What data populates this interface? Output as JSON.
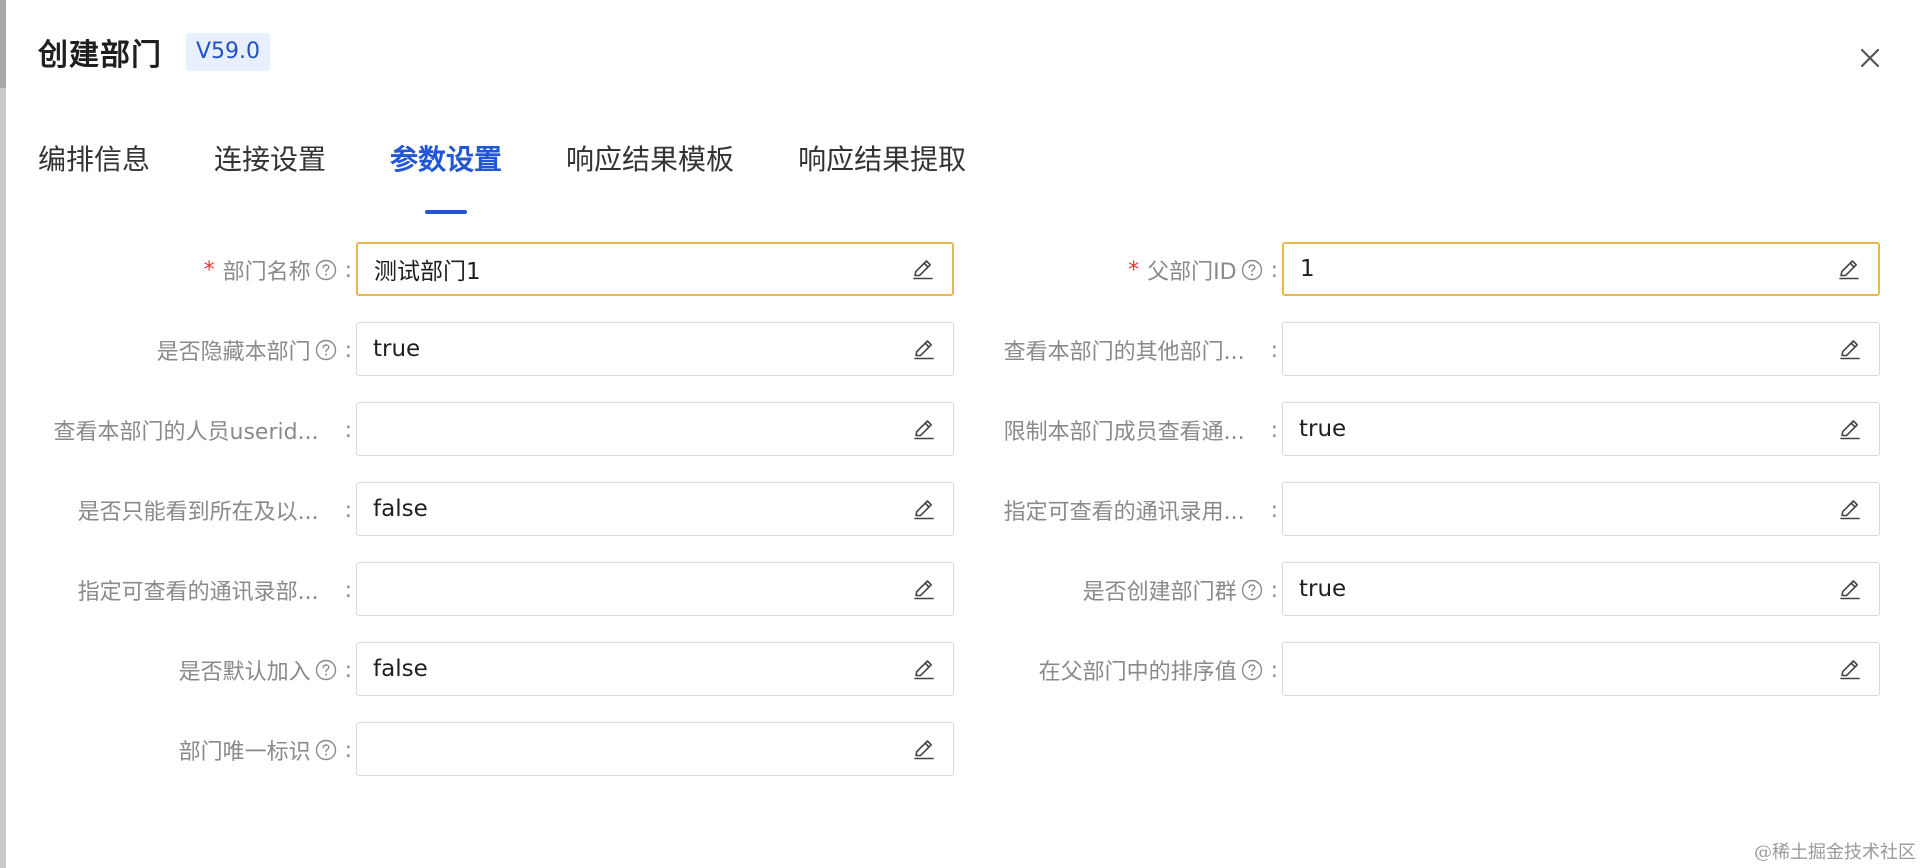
{
  "dialog": {
    "title": "创建部门",
    "version": "V59.0"
  },
  "tabs": [
    {
      "label": "编排信息",
      "active": false
    },
    {
      "label": "连接设置",
      "active": false
    },
    {
      "label": "参数设置",
      "active": true
    },
    {
      "label": "响应结果模板",
      "active": false
    },
    {
      "label": "响应结果提取",
      "active": false
    }
  ],
  "form": {
    "fields": [
      {
        "label": "部门名称",
        "required": true,
        "help": true,
        "value": "测试部门1",
        "focused": true
      },
      {
        "label": "父部门ID",
        "required": true,
        "help": true,
        "value": "1",
        "focused": true
      },
      {
        "label": "是否隐藏本部门",
        "required": false,
        "help": true,
        "value": "true"
      },
      {
        "label": "查看本部门的其他部门...",
        "required": false,
        "help": false,
        "value": ""
      },
      {
        "label": "查看本部门的人员userid...",
        "required": false,
        "help": false,
        "value": ""
      },
      {
        "label": "限制本部门成员查看通...",
        "required": false,
        "help": false,
        "value": "true"
      },
      {
        "label": "是否只能看到所在及以...",
        "required": false,
        "help": false,
        "value": "false"
      },
      {
        "label": "指定可查看的通讯录用...",
        "required": false,
        "help": false,
        "value": ""
      },
      {
        "label": "指定可查看的通讯录部...",
        "required": false,
        "help": false,
        "value": ""
      },
      {
        "label": "是否创建部门群",
        "required": false,
        "help": true,
        "value": "true"
      },
      {
        "label": "是否默认加入",
        "required": false,
        "help": true,
        "value": "false"
      },
      {
        "label": "在父部门中的排序值",
        "required": false,
        "help": true,
        "value": ""
      },
      {
        "label": "部门唯一标识",
        "required": false,
        "help": true,
        "value": ""
      }
    ],
    "required_mark": "*",
    "colon": ":"
  },
  "watermark": "@稀土掘金技术社区",
  "colors": {
    "accent": "#2156d4",
    "focus_border": "#e8b84a",
    "required": "#e23838",
    "badge_bg": "#e8efff"
  },
  "icons": {
    "close": "close-icon",
    "edit": "pencil-edit-icon",
    "help": "question-circle-icon"
  }
}
